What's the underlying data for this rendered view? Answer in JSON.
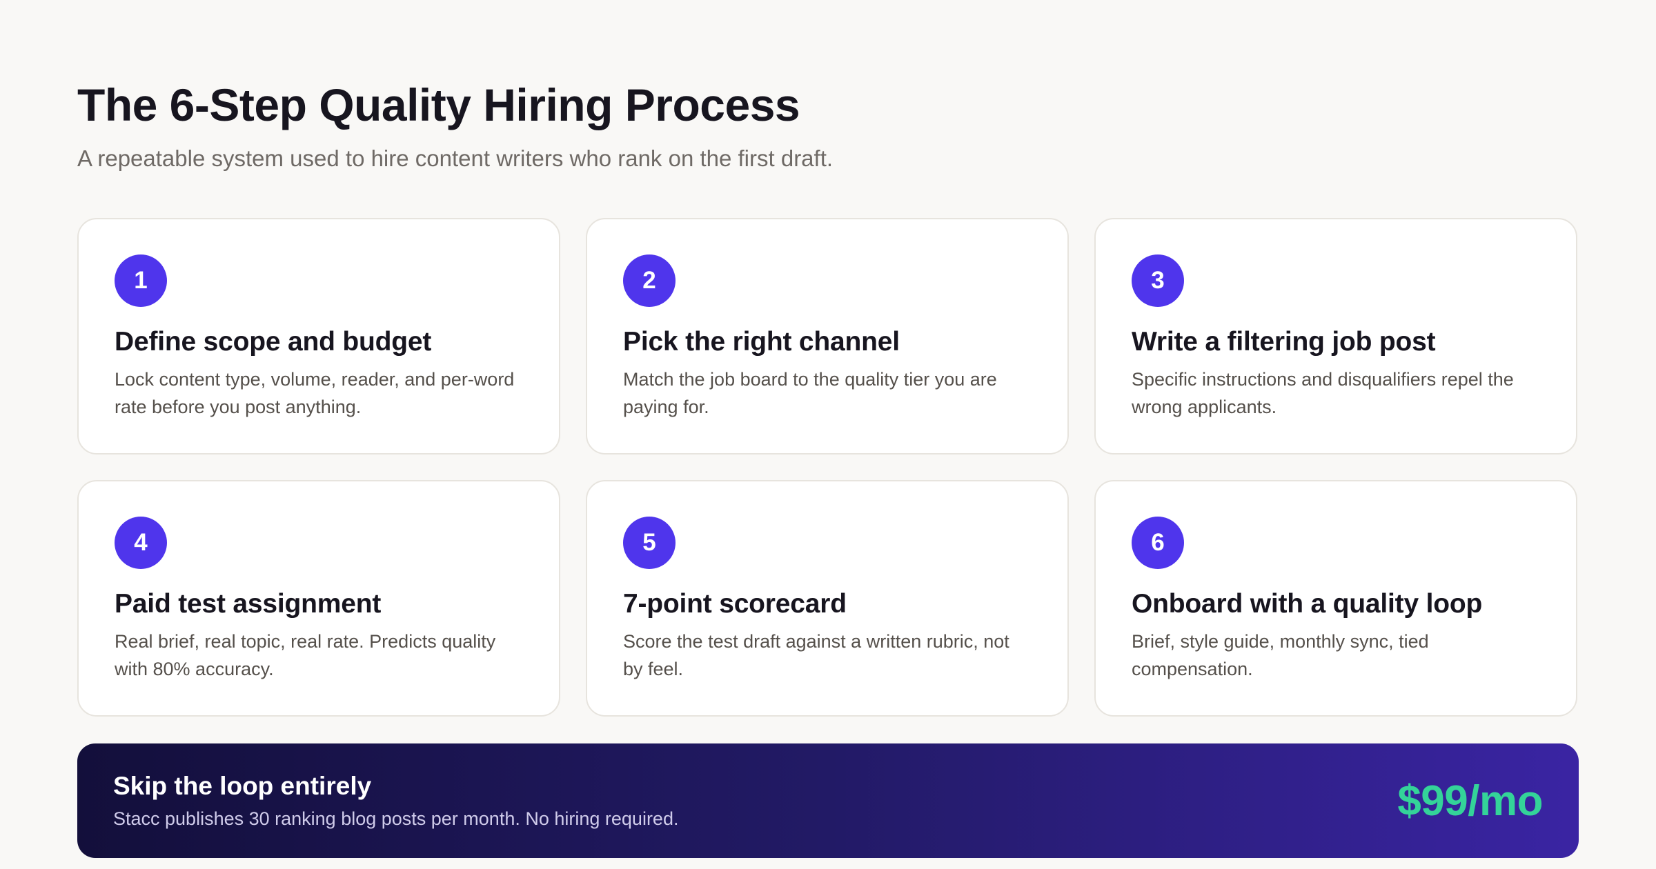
{
  "header": {
    "title": "The 6-Step Quality Hiring Process",
    "subtitle": "A repeatable system used to hire content writers who rank on the first draft."
  },
  "steps": [
    {
      "number": "1",
      "title": "Define scope and budget",
      "description": "Lock content type, volume, reader, and per-word rate before you post anything."
    },
    {
      "number": "2",
      "title": "Pick the right channel",
      "description": "Match the job board to the quality tier you are paying for."
    },
    {
      "number": "3",
      "title": "Write a filtering job post",
      "description": "Specific instructions and disqualifiers repel the wrong applicants."
    },
    {
      "number": "4",
      "title": "Paid test assignment",
      "description": "Real brief, real topic, real rate. Predicts quality with 80% accuracy."
    },
    {
      "number": "5",
      "title": "7-point scorecard",
      "description": "Score the test draft against a written rubric, not by feel."
    },
    {
      "number": "6",
      "title": "Onboard with a quality loop",
      "description": "Brief, style guide, monthly sync, tied compensation."
    }
  ],
  "cta": {
    "title": "Skip the loop entirely",
    "subtitle": "Stacc publishes 30 ranking blog posts per month. No hiring required.",
    "price": "$99/mo"
  },
  "colors": {
    "accent": "#4f35ec",
    "price": "#34d399",
    "background": "#f9f8f6"
  }
}
